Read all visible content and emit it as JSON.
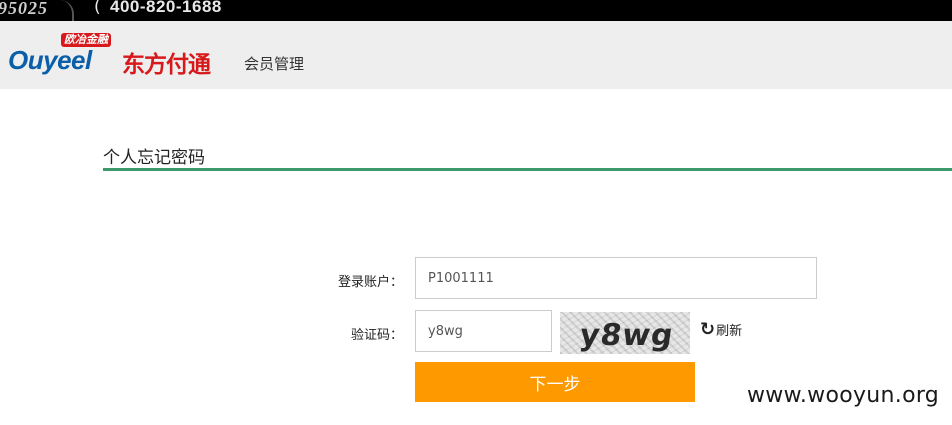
{
  "topbar": {
    "hotline_a": "95025",
    "phone_icon": "phone-icon",
    "hotline_b": "400-820-1688"
  },
  "header": {
    "logo_latin": "Ouyeel",
    "logo_badge": "欧冶金融",
    "logo_brand": "东方付通",
    "subtitle": "会员管理"
  },
  "page": {
    "section_title": "个人忘记密码"
  },
  "form": {
    "account_label": "登录账户：",
    "account_value": "P1001111",
    "captcha_label": "验证码：",
    "captcha_value": "y8wg",
    "captcha_image_text": "y8wg",
    "refresh_icon": "refresh-icon",
    "refresh_label": "刷新",
    "next_label": "下一步"
  },
  "colors": {
    "header_bg": "#eeeeee",
    "topbar_bg": "#000000",
    "accent_rule": "#3a9a6a",
    "button_bg": "#ff9900",
    "brand_red": "#d7191c",
    "brand_blue": "#0b5fa8"
  },
  "watermark": "www.wooyun.org"
}
